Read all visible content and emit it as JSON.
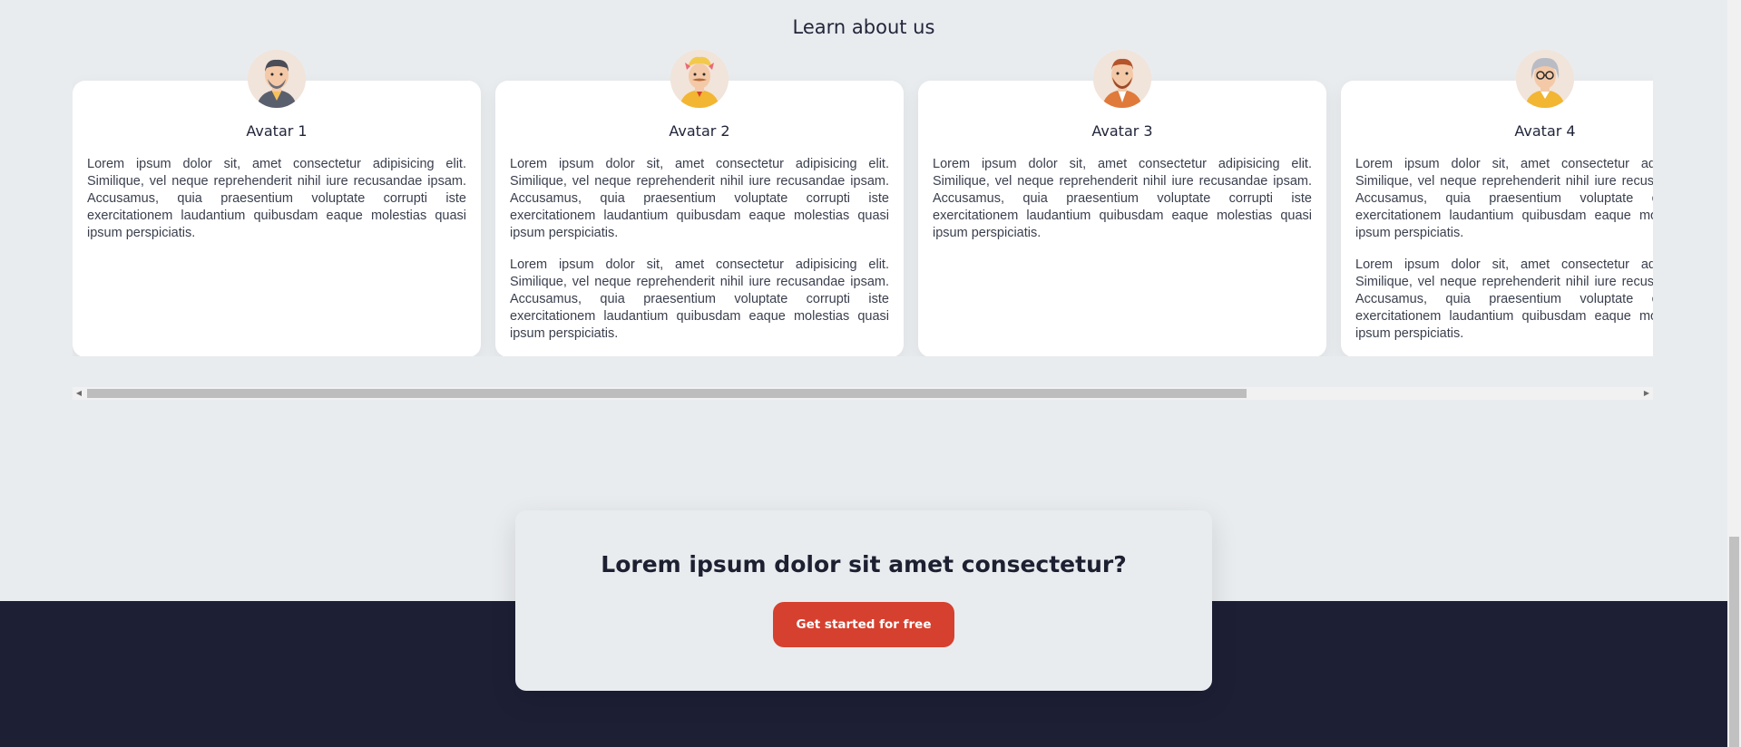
{
  "section": {
    "title": "Learn about us"
  },
  "cards": [
    {
      "name": "Avatar 1",
      "avatar_icon": "avatar-1-icon",
      "paragraphs": [
        "Lorem ipsum dolor sit, amet consectetur adipisicing elit. Similique, vel neque reprehenderit nihil iure recusandae ipsam. Accusamus, quia praesentium voluptate corrupti iste exercitationem laudantium quibusdam eaque molestias quasi ipsum perspiciatis."
      ]
    },
    {
      "name": "Avatar 2",
      "avatar_icon": "avatar-2-icon",
      "paragraphs": [
        "Lorem ipsum dolor sit, amet consectetur adipisicing elit. Similique, vel neque reprehenderit nihil iure recusandae ipsam. Accusamus, quia praesentium voluptate corrupti iste exercitationem laudantium quibusdam eaque molestias quasi ipsum perspiciatis.",
        "Lorem ipsum dolor sit, amet consectetur adipisicing elit. Similique, vel neque reprehenderit nihil iure recusandae ipsam. Accusamus, quia praesentium voluptate corrupti iste exercitationem laudantium quibusdam eaque molestias quasi ipsum perspiciatis."
      ]
    },
    {
      "name": "Avatar 3",
      "avatar_icon": "avatar-3-icon",
      "paragraphs": [
        "Lorem ipsum dolor sit, amet consectetur adipisicing elit. Similique, vel neque reprehenderit nihil iure recusandae ipsam. Accusamus, quia praesentium voluptate corrupti iste exercitationem laudantium quibusdam eaque molestias quasi ipsum perspiciatis."
      ]
    },
    {
      "name": "Avatar 4",
      "avatar_icon": "avatar-4-icon",
      "paragraphs": [
        "Lorem ipsum dolor sit, amet consectetur adipisicing elit. Similique, vel neque reprehenderit nihil iure recusandae ipsam. Accusamus, quia praesentium voluptate corrupti iste exercitationem laudantium quibusdam eaque molestias quasi ipsum perspiciatis.",
        "Lorem ipsum dolor sit, amet consectetur adipisicing elit. Similique, vel neque reprehenderit nihil iure recusandae ipsam. Accusamus, quia praesentium voluptate corrupti iste exercitationem laudantium quibusdam eaque molestias quasi ipsum perspiciatis."
      ]
    }
  ],
  "cta": {
    "title": "Lorem ipsum dolor sit amet consectetur?",
    "button_label": "Get started for free"
  },
  "colors": {
    "background": "#e9ecef",
    "footer": "#1d2035",
    "accent": "#d6402f"
  }
}
